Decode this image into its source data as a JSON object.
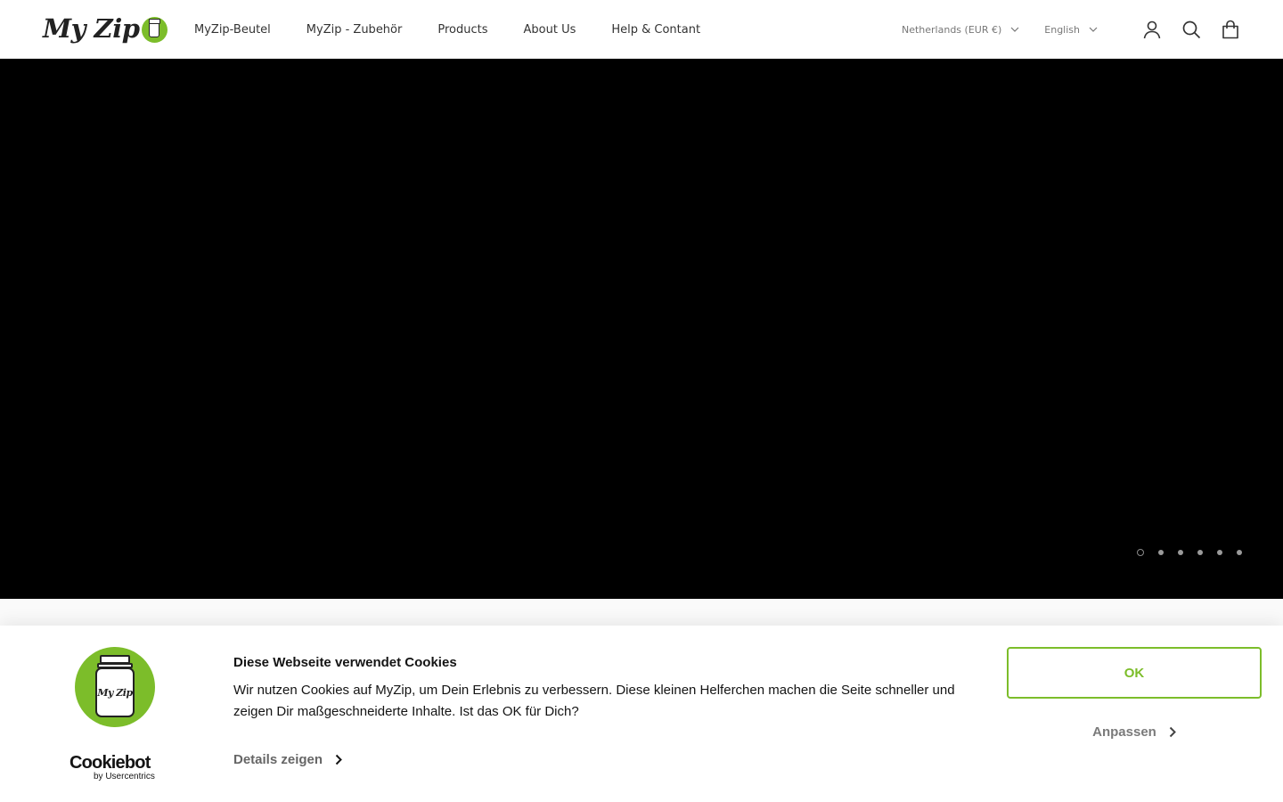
{
  "header": {
    "logo": {
      "text": "My Zip"
    },
    "nav": [
      {
        "label": "MyZip-Beutel"
      },
      {
        "label": "MyZip - Zubehör"
      },
      {
        "label": "Products"
      },
      {
        "label": "About Us"
      },
      {
        "label": "Help & Contant"
      }
    ],
    "country_selector": "Netherlands (EUR €)",
    "language_selector": "English",
    "icons": [
      "account-icon",
      "search-icon",
      "cart-icon"
    ]
  },
  "hero": {
    "background": "#000000",
    "slides_count": 6,
    "active_slide": 1
  },
  "cookie_banner": {
    "brand_logo_text": "My Zip",
    "provider": "Cookiebot",
    "provider_sub": "by Usercentrics",
    "title": "Diese Webseite verwendet Cookies",
    "body": "Wir nutzen Cookies auf MyZip, um Dein Erlebnis zu verbessern. Diese kleinen Helferchen machen die Seite schneller und zeigen Dir maßgeschneiderte Inhalte. Ist das OK für Dich?",
    "details_label": "Details zeigen",
    "ok_label": "OK",
    "customize_label": "Anpassen"
  },
  "colors": {
    "accent": "#7cbd2a",
    "hero": "#000000",
    "text": "#141414"
  }
}
